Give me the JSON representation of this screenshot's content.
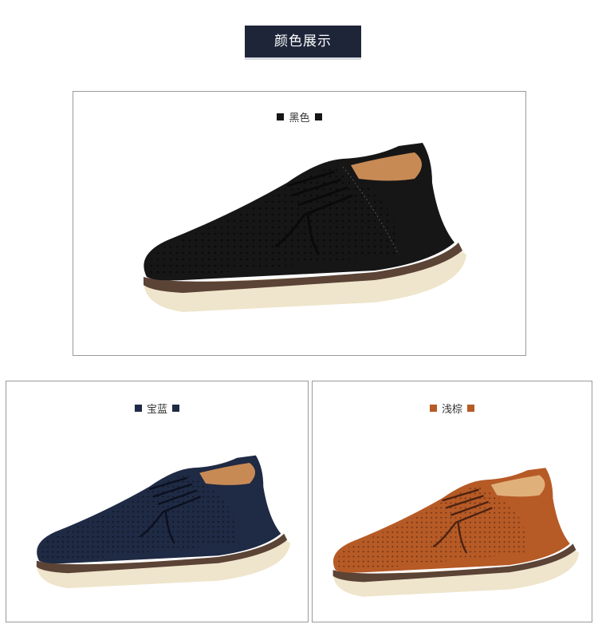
{
  "header": {
    "title": "颜色展示"
  },
  "colors": {
    "banner_bg": "#1e2539",
    "black": "#161616",
    "navy": "#1f2a44",
    "tan": "#b65a26",
    "sole": "#efe5cc",
    "sole_line": "#5b4336"
  },
  "variants": [
    {
      "label": "黑色",
      "swatch": "#161616"
    },
    {
      "label": "宝蓝",
      "swatch": "#1f2a44"
    },
    {
      "label": "浅棕",
      "swatch": "#b65a26"
    }
  ]
}
